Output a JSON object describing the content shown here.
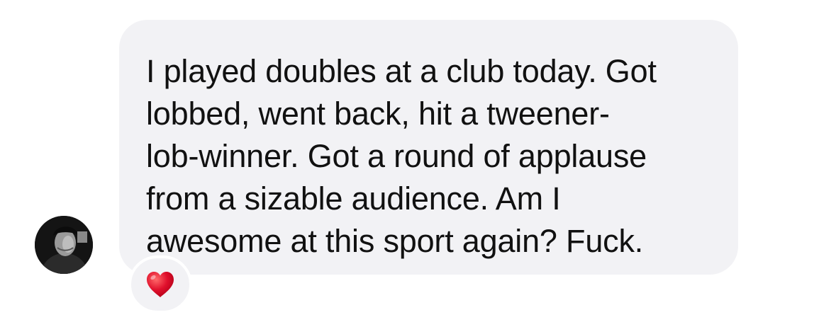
{
  "message": {
    "text": "I played doubles at a club today. Got\nlobbed, went back, hit a tweener-\nlob-winner. Got a round of applause\nfrom a sizable audience. Am I\nawesome at this sport again? Fuck.",
    "reaction_icon": "red-heart-icon",
    "reaction_color": "#e0102c",
    "bubble_color": "#f2f2f5"
  },
  "sender": {
    "avatar_icon": "profile-photo"
  }
}
